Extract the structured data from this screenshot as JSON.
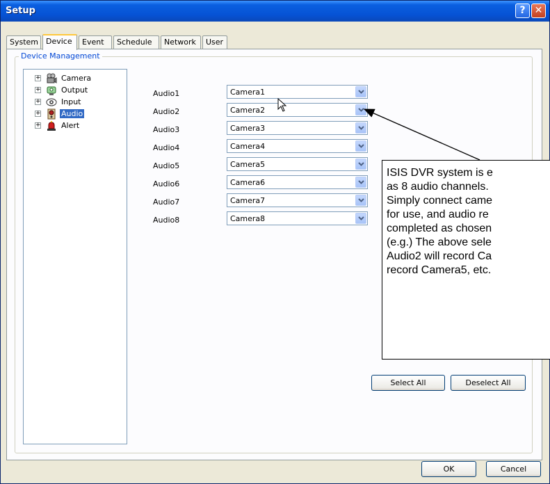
{
  "window": {
    "title": "Setup",
    "help_glyph": "?",
    "close_glyph": "✕"
  },
  "tabs": [
    {
      "label": "System",
      "active": false
    },
    {
      "label": "Device",
      "active": true
    },
    {
      "label": "Event",
      "active": false
    },
    {
      "label": "Schedule",
      "active": false
    },
    {
      "label": "Network",
      "active": false
    },
    {
      "label": "User",
      "active": false
    }
  ],
  "group": {
    "label": "Device Management"
  },
  "tree": {
    "items": [
      {
        "label": "Camera",
        "icon": "camera-icon",
        "selected": false
      },
      {
        "label": "Output",
        "icon": "output-icon",
        "selected": false
      },
      {
        "label": "Input",
        "icon": "input-icon",
        "selected": false
      },
      {
        "label": "Audio",
        "icon": "audio-icon",
        "selected": true
      },
      {
        "label": "Alert",
        "icon": "alert-icon",
        "selected": false
      }
    ],
    "expander_glyph": "+"
  },
  "audio_rows": [
    {
      "label": "Audio1",
      "value": "Camera1"
    },
    {
      "label": "Audio2",
      "value": "Camera2"
    },
    {
      "label": "Audio3",
      "value": "Camera3"
    },
    {
      "label": "Audio4",
      "value": "Camera4"
    },
    {
      "label": "Audio5",
      "value": "Camera5"
    },
    {
      "label": "Audio6",
      "value": "Camera6"
    },
    {
      "label": "Audio7",
      "value": "Camera7"
    },
    {
      "label": "Audio8",
      "value": "Camera8"
    }
  ],
  "buttons": {
    "select_all": "Select All",
    "deselect_all": "Deselect All",
    "ok": "OK",
    "cancel": "Cancel"
  },
  "annotation": {
    "lines": [
      "ISIS DVR system is e",
      "as 8 audio channels.",
      "Simply connect came",
      "for use, and audio re",
      "completed as chosen",
      "(e.g.) The above sele",
      "Audio2 will record Ca",
      "record Camera5, etc."
    ]
  },
  "colors": {
    "titlebar": "#0a5fe0",
    "selection": "#316ac5",
    "group_label": "#0046d5",
    "tab_highlight": "#ffc83c"
  }
}
